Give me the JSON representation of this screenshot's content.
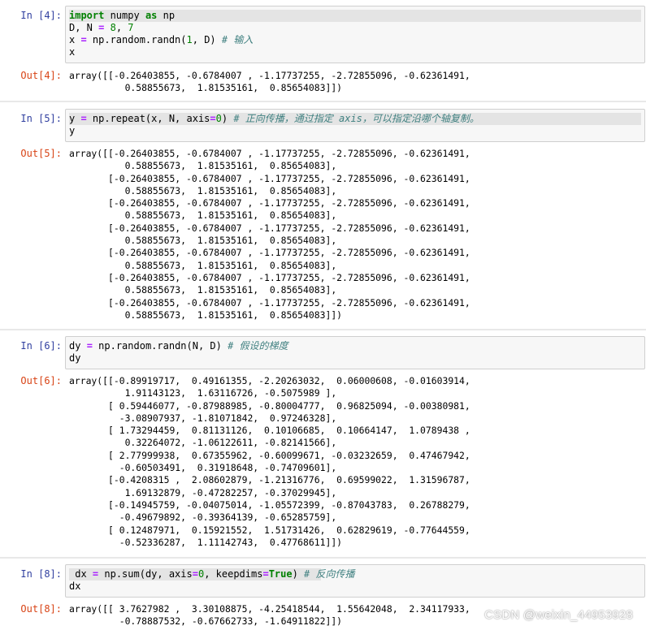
{
  "cells": [
    {
      "in_prompt": "In  [4]:",
      "code": [
        {
          "parts": [
            [
              "kw",
              "import"
            ],
            [
              "pl",
              " numpy "
            ],
            [
              "kw",
              "as"
            ],
            [
              "pl",
              " np"
            ]
          ]
        },
        {
          "parts": [
            [
              "pl",
              "D, N "
            ],
            [
              "op",
              "="
            ],
            [
              "pl",
              " "
            ],
            [
              "num",
              "8"
            ],
            [
              "pl",
              ", "
            ],
            [
              "num",
              "7"
            ]
          ]
        },
        {
          "parts": [
            [
              "pl",
              "x "
            ],
            [
              "op",
              "="
            ],
            [
              "pl",
              " np.random.randn("
            ],
            [
              "num",
              "1"
            ],
            [
              "pl",
              ", D) "
            ],
            [
              "cm",
              "# 输入"
            ]
          ]
        },
        {
          "parts": [
            [
              "pl",
              "x"
            ]
          ]
        }
      ],
      "out_prompt": "Out[4]:",
      "output": "array([[-0.26403855, -0.6784007 , -1.17737255, -2.72855096, -0.62361491,\n          0.58855673,  1.81535161,  0.85654083]])"
    },
    {
      "in_prompt": "In  [5]:",
      "code": [
        {
          "parts": [
            [
              "pl",
              "y "
            ],
            [
              "op",
              "="
            ],
            [
              "pl",
              " np.repeat(x, N, axis"
            ],
            [
              "op",
              "="
            ],
            [
              "num",
              "0"
            ],
            [
              "pl",
              ") "
            ],
            [
              "cm",
              "# 正向传播，通过指定 axis，可以指定沿哪个轴复制。"
            ]
          ]
        },
        {
          "parts": [
            [
              "pl",
              "y"
            ]
          ]
        }
      ],
      "out_prompt": "Out[5]:",
      "output": "array([[-0.26403855, -0.6784007 , -1.17737255, -2.72855096, -0.62361491,\n          0.58855673,  1.81535161,  0.85654083],\n       [-0.26403855, -0.6784007 , -1.17737255, -2.72855096, -0.62361491,\n          0.58855673,  1.81535161,  0.85654083],\n       [-0.26403855, -0.6784007 , -1.17737255, -2.72855096, -0.62361491,\n          0.58855673,  1.81535161,  0.85654083],\n       [-0.26403855, -0.6784007 , -1.17737255, -2.72855096, -0.62361491,\n          0.58855673,  1.81535161,  0.85654083],\n       [-0.26403855, -0.6784007 , -1.17737255, -2.72855096, -0.62361491,\n          0.58855673,  1.81535161,  0.85654083],\n       [-0.26403855, -0.6784007 , -1.17737255, -2.72855096, -0.62361491,\n          0.58855673,  1.81535161,  0.85654083],\n       [-0.26403855, -0.6784007 , -1.17737255, -2.72855096, -0.62361491,\n          0.58855673,  1.81535161,  0.85654083]])"
    },
    {
      "in_prompt": "In  [6]:",
      "code": [
        {
          "parts": [
            [
              "pl",
              "dy "
            ],
            [
              "op",
              "="
            ],
            [
              "pl",
              " np.random.randn(N, D) "
            ],
            [
              "cm",
              "# 假设的梯度"
            ]
          ]
        },
        {
          "parts": [
            [
              "pl",
              "dy"
            ]
          ]
        }
      ],
      "out_prompt": "Out[6]:",
      "output": "array([[-0.89919717,  0.49161355, -2.20263032,  0.06000608, -0.01603914,\n          1.91143123,  1.63116726, -0.5075989 ],\n       [ 0.59446077, -0.87988985, -0.80004777,  0.96825094, -0.00380981,\n         -3.08907937, -1.81071842,  0.97246328],\n       [ 1.73294459,  0.81131126,  0.10106685,  0.10664147,  1.0789438 ,\n          0.32264072, -1.06122611, -0.82141566],\n       [ 2.77999938,  0.67355962, -0.60099671, -0.03232659,  0.47467942,\n         -0.60503491,  0.31918648, -0.74709601],\n       [-0.4208315 ,  2.08602879, -1.21316776,  0.69599022,  1.31596787,\n          1.69132879, -0.47282257, -0.37029945],\n       [-0.14945759, -0.04075014, -1.05572399, -0.87043783,  0.26788279,\n         -0.49679892, -0.39364139, -0.65285759],\n       [ 0.12487971,  0.15921552,  1.51731426,  0.62829619, -0.77644559,\n         -0.52336287,  1.11142743,  0.47768611]])"
    },
    {
      "in_prompt": "In  [8]:",
      "code": [
        {
          "parts": [
            [
              "pl",
              " dx "
            ],
            [
              "op",
              "="
            ],
            [
              "pl",
              " np.sum(dy, axis"
            ],
            [
              "op",
              "="
            ],
            [
              "num",
              "0"
            ],
            [
              "pl",
              ", keepdims"
            ],
            [
              "op",
              "="
            ],
            [
              "kw",
              "True"
            ],
            [
              "pl",
              ") "
            ],
            [
              "cm",
              "# 反向传播"
            ]
          ]
        },
        {
          "parts": [
            [
              "pl",
              "dx"
            ]
          ]
        }
      ],
      "out_prompt": "Out[8]:",
      "output": "array([[ 3.7627982 ,  3.30108875, -4.25418544,  1.55642048,  2.34117933,\n         -0.78887532, -0.67662733, -1.64911822]])"
    }
  ],
  "watermark": "CSDN @weixin_44953928"
}
